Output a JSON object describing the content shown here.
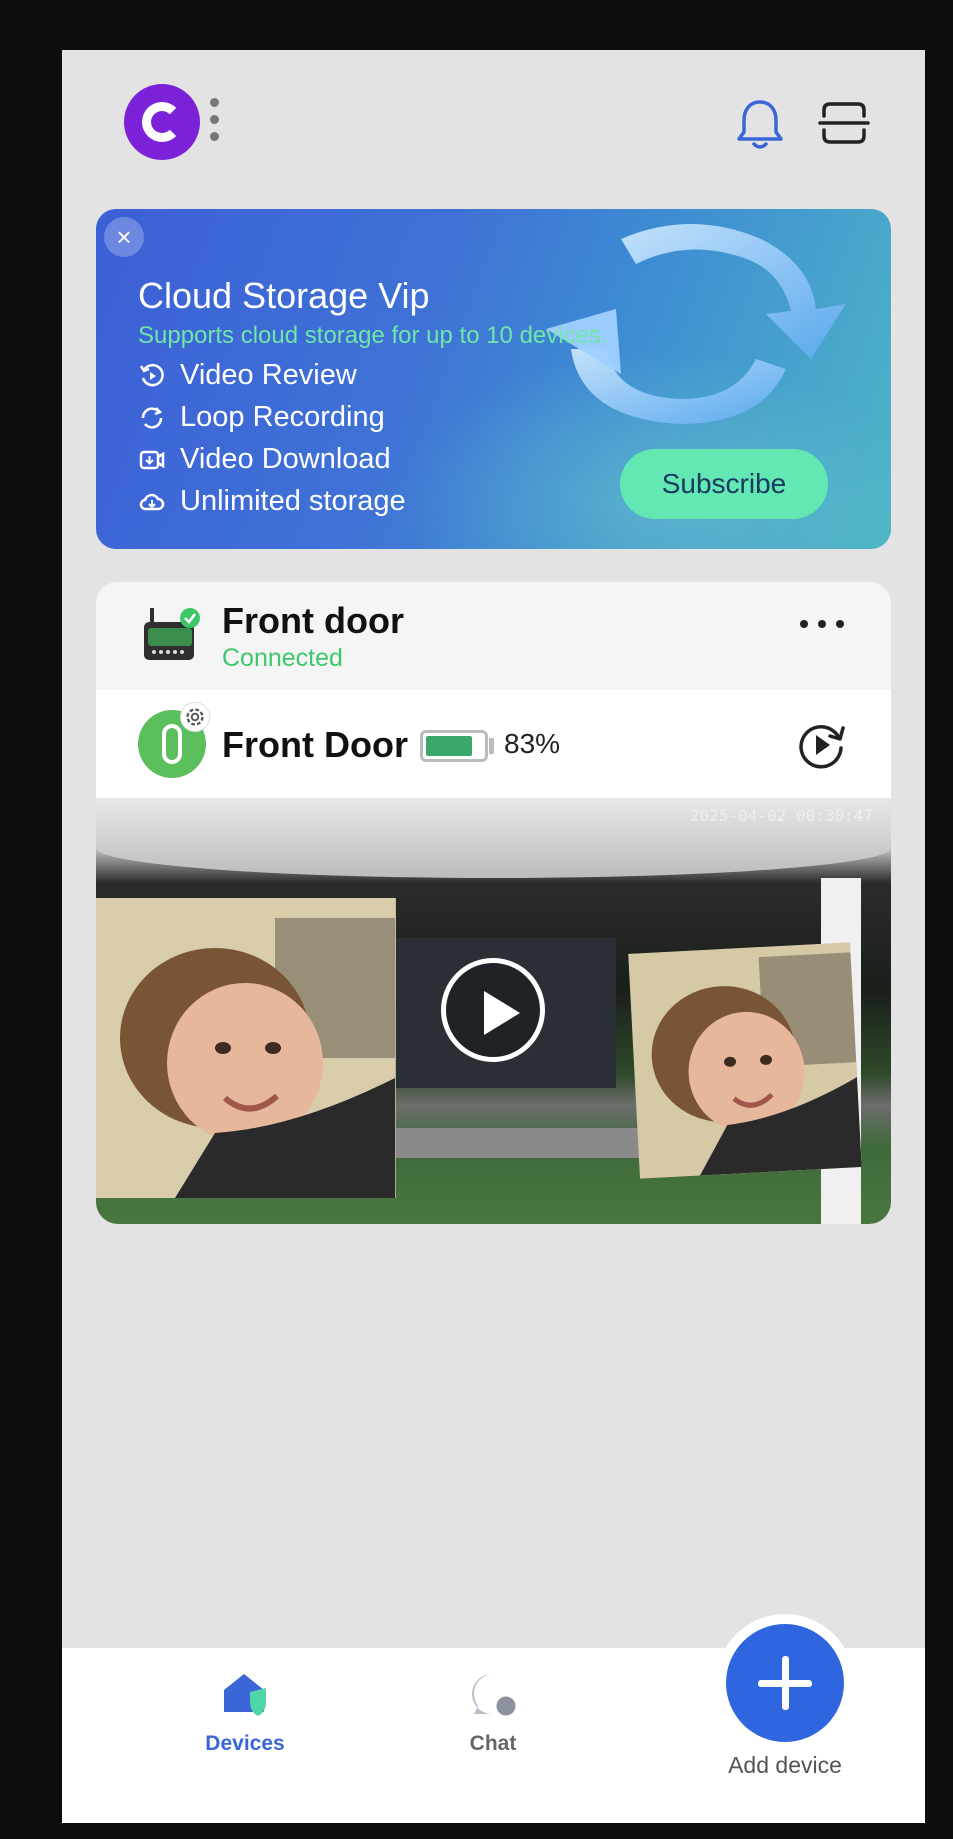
{
  "header": {
    "logo_icon": "app-logo-c",
    "bell_icon": "bell-icon",
    "scan_icon": "scan-icon"
  },
  "banner": {
    "close_glyph": "×",
    "title": "Cloud Storage Vip",
    "subtitle": "Supports cloud storage for up to 10 devices.",
    "features": [
      {
        "icon": "replay-icon",
        "label": "Video Review"
      },
      {
        "icon": "loop-icon",
        "label": "Loop Recording"
      },
      {
        "icon": "download-icon",
        "label": "Video Download"
      },
      {
        "icon": "cloud-icon",
        "label": "Unlimited storage"
      }
    ],
    "subscribe_label": "Subscribe",
    "colors": {
      "accent": "#63e7b3",
      "subtitle": "#6ee7a8"
    }
  },
  "hub": {
    "name": "Front door",
    "status": "Connected",
    "status_color": "#3cc86a"
  },
  "camera": {
    "name": "Front Door",
    "battery_percent_label": "83%",
    "battery_level": 0.83,
    "timestamp": "2025-04-02 00:30:47"
  },
  "nav": {
    "devices_label": "Devices",
    "chat_label": "Chat",
    "add_label": "Add device",
    "active_color": "#3a66d8"
  }
}
